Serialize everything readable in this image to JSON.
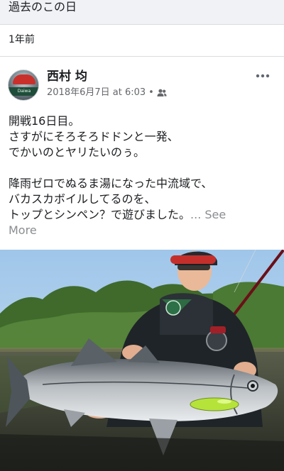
{
  "memories_header": {
    "title": "過去のこの日"
  },
  "time_ago": "1年前",
  "post": {
    "author": "西村 均",
    "avatar_text": "Daiwa",
    "timestamp": "2018年6月7日 at 6:03",
    "separator": "•",
    "privacy_icon": "friends-icon",
    "more_icon": "more-options-icon",
    "lines": [
      "開戦16日目。",
      "さすがにそろそろドドンと一発、",
      "でかいのとヤリたいのぅ。",
      "",
      "降雨ゼロでぬるま湯になった中流域で、",
      "バカスカボイルしてるのを、",
      "トップとシンペン？で遊びました。"
    ],
    "see_more_prefix": "... ",
    "see_more": "See",
    "see_more_line2": "More"
  },
  "colors": {
    "header_bg": "#f0f2f5",
    "text": "#1c1e21",
    "secondary_text": "#65676b",
    "see_more": "#8a8d91",
    "lure": "#b6e33a"
  }
}
